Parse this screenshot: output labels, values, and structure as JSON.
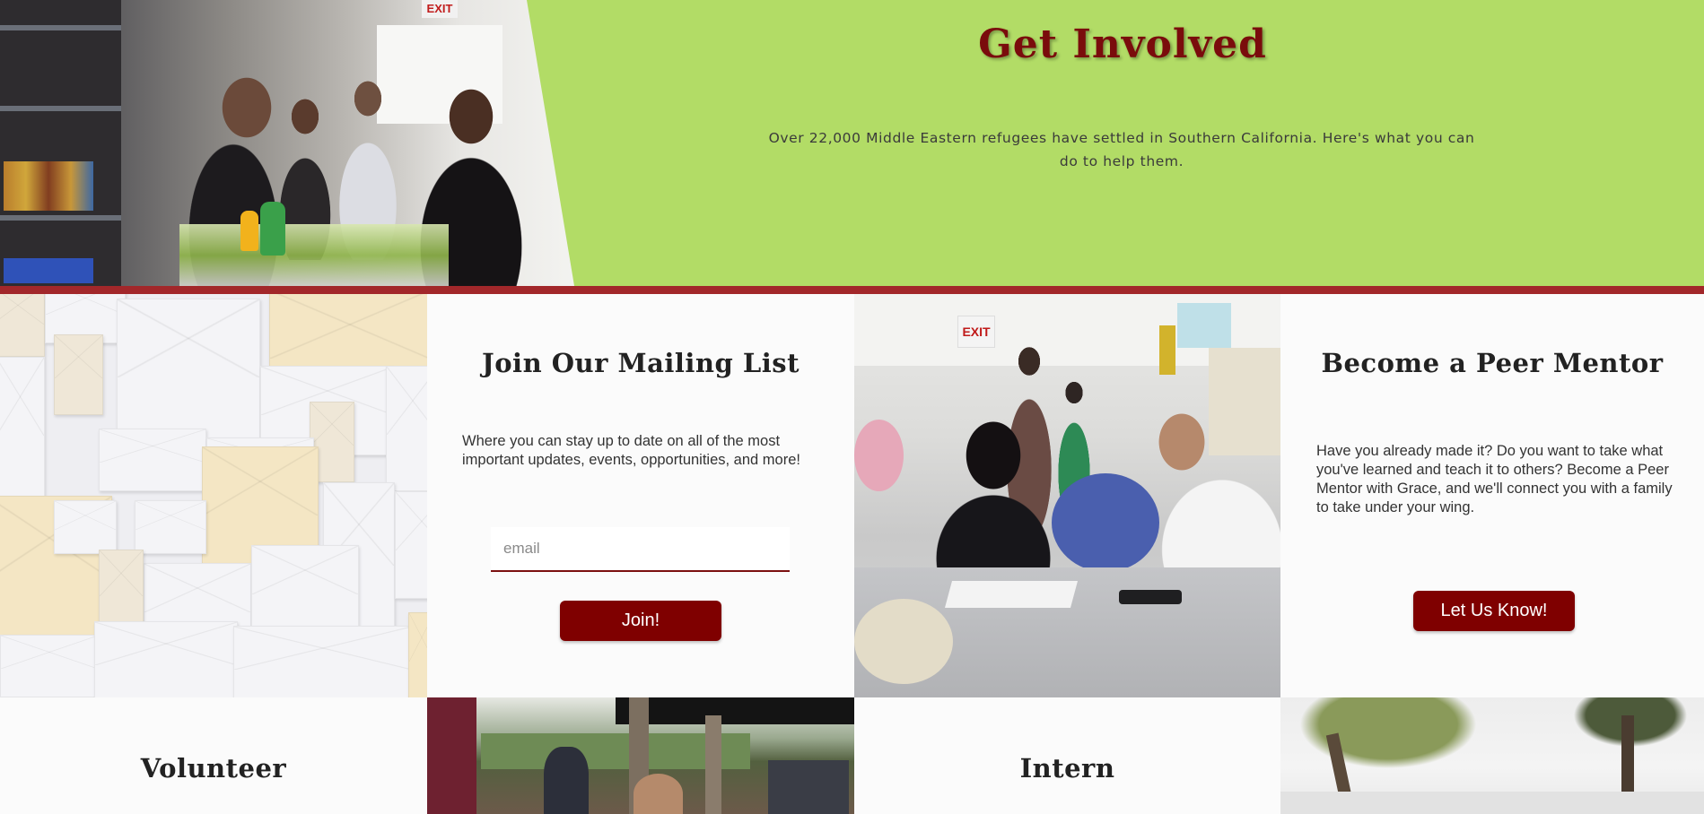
{
  "hero": {
    "title": "Get Involved",
    "text": "Over 22,000 Middle Eastern refugees have settled in Southern California. Here's what you can do to help them.",
    "photo_sign": "EXIT"
  },
  "mailing": {
    "title": "Join Our Mailing List",
    "text": "Where you can stay up to date on all of the most important updates, events, opportunities, and more!",
    "email_placeholder": "email",
    "button_label": "Join!"
  },
  "mentor_photo": {
    "sign": "EXIT"
  },
  "peer_mentor": {
    "title": "Become a Peer Mentor",
    "text": "Have you already made it? Do you want to take what you've learned and teach it to others? Become a Peer Mentor with Grace, and we'll connect you with a family to take under your wing.",
    "button_label": "Let Us Know!"
  },
  "volunteer": {
    "title": "Volunteer"
  },
  "intern": {
    "title": "Intern"
  },
  "colors": {
    "hero_background": "#b2dc66",
    "accent_red": "#7f0000",
    "divider": "#a2272a",
    "title_red": "#7a0c0c"
  }
}
